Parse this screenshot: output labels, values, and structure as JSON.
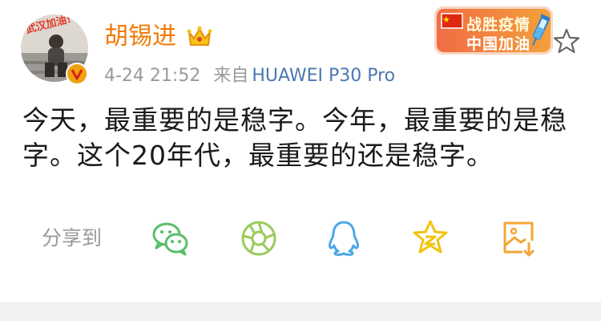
{
  "post": {
    "author": "胡锡进",
    "time": "4-24 21:52",
    "source_prefix": "来自",
    "device": "HUAWEI P30 Pro",
    "text": "今天，最重要的是稳字。今年，最重要的是稳字。这个20年代，最重要的还是稳字。",
    "avatar_caption": "武汉加油!"
  },
  "campaign_badge": {
    "line1": "战胜疫情",
    "line2": "中国加油"
  },
  "share": {
    "label": "分享到",
    "targets": [
      "wechat-icon",
      "moments-icon",
      "qq-icon",
      "qzone-icon",
      "save-image-icon"
    ]
  },
  "colors": {
    "username": "#f17a07",
    "device_link": "#4a79b1",
    "meta": "#9a9a9a",
    "wechat": "#58be6a",
    "moments": "#9acb5b",
    "qq": "#4aa9e8",
    "qzone": "#f1c40f",
    "save": "#f3a536",
    "badge_from": "#f06b45",
    "badge_to": "#f3a23a"
  }
}
